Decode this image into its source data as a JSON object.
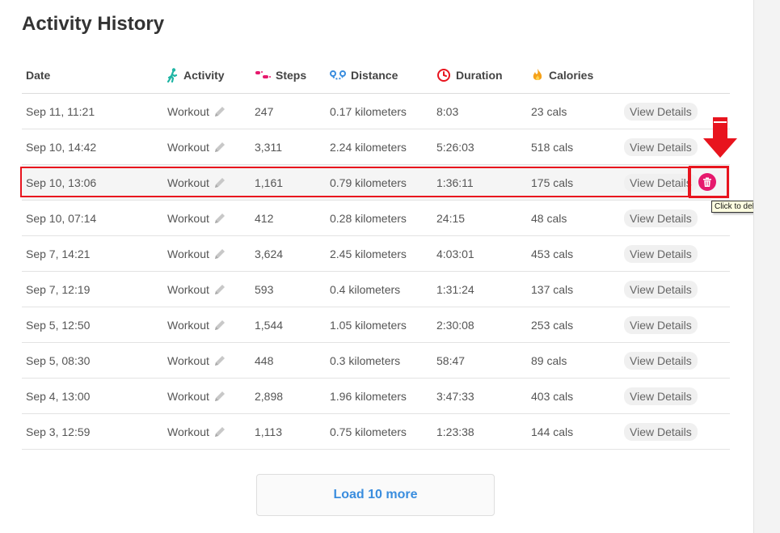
{
  "page": {
    "title": "Activity History"
  },
  "table": {
    "headers": {
      "date": "Date",
      "activity": "Activity",
      "steps": "Steps",
      "distance": "Distance",
      "duration": "Duration",
      "calories": "Calories"
    },
    "rows": [
      {
        "date": "Sep 11, 11:21",
        "activity": "Workout",
        "steps": "247",
        "distance": "0.17 kilometers",
        "duration": "8:03",
        "calories": "23 cals",
        "view": "View Details"
      },
      {
        "date": "Sep 10, 14:42",
        "activity": "Workout",
        "steps": "3,311",
        "distance": "2.24 kilometers",
        "duration": "5:26:03",
        "calories": "518 cals",
        "view": "View Details"
      },
      {
        "date": "Sep 10, 13:06",
        "activity": "Workout",
        "steps": "1,161",
        "distance": "0.79 kilometers",
        "duration": "1:36:11",
        "calories": "175 cals",
        "view": "View Details"
      },
      {
        "date": "Sep 10, 07:14",
        "activity": "Workout",
        "steps": "412",
        "distance": "0.28 kilometers",
        "duration": "24:15",
        "calories": "48 cals",
        "view": "View Details"
      },
      {
        "date": "Sep 7, 14:21",
        "activity": "Workout",
        "steps": "3,624",
        "distance": "2.45 kilometers",
        "duration": "4:03:01",
        "calories": "453 cals",
        "view": "View Details"
      },
      {
        "date": "Sep 7, 12:19",
        "activity": "Workout",
        "steps": "593",
        "distance": "0.4 kilometers",
        "duration": "1:31:24",
        "calories": "137 cals",
        "view": "View Details"
      },
      {
        "date": "Sep 5, 12:50",
        "activity": "Workout",
        "steps": "1,544",
        "distance": "1.05 kilometers",
        "duration": "2:30:08",
        "calories": "253 cals",
        "view": "View Details"
      },
      {
        "date": "Sep 5, 08:30",
        "activity": "Workout",
        "steps": "448",
        "distance": "0.3 kilometers",
        "duration": "58:47",
        "calories": "89 cals",
        "view": "View Details"
      },
      {
        "date": "Sep 4, 13:00",
        "activity": "Workout",
        "steps": "2,898",
        "distance": "1.96 kilometers",
        "duration": "3:47:33",
        "calories": "403 cals",
        "view": "View Details"
      },
      {
        "date": "Sep 3, 12:59",
        "activity": "Workout",
        "steps": "1,113",
        "distance": "0.75 kilometers",
        "duration": "1:23:38",
        "calories": "144 cals",
        "view": "View Details"
      }
    ]
  },
  "tooltip": {
    "text": "Click to delete"
  },
  "load_more": {
    "label": "Load 10 more"
  },
  "icons": {
    "activity": "walking-person-icon",
    "steps": "footprints-icon",
    "distance": "route-icon",
    "duration": "clock-icon",
    "calories": "flame-icon",
    "edit": "pencil-icon",
    "delete": "trash-icon"
  },
  "colors": {
    "accent_blue": "#3a8dde",
    "delete_pink": "#e6196d",
    "annotation_red": "#e8141e"
  }
}
